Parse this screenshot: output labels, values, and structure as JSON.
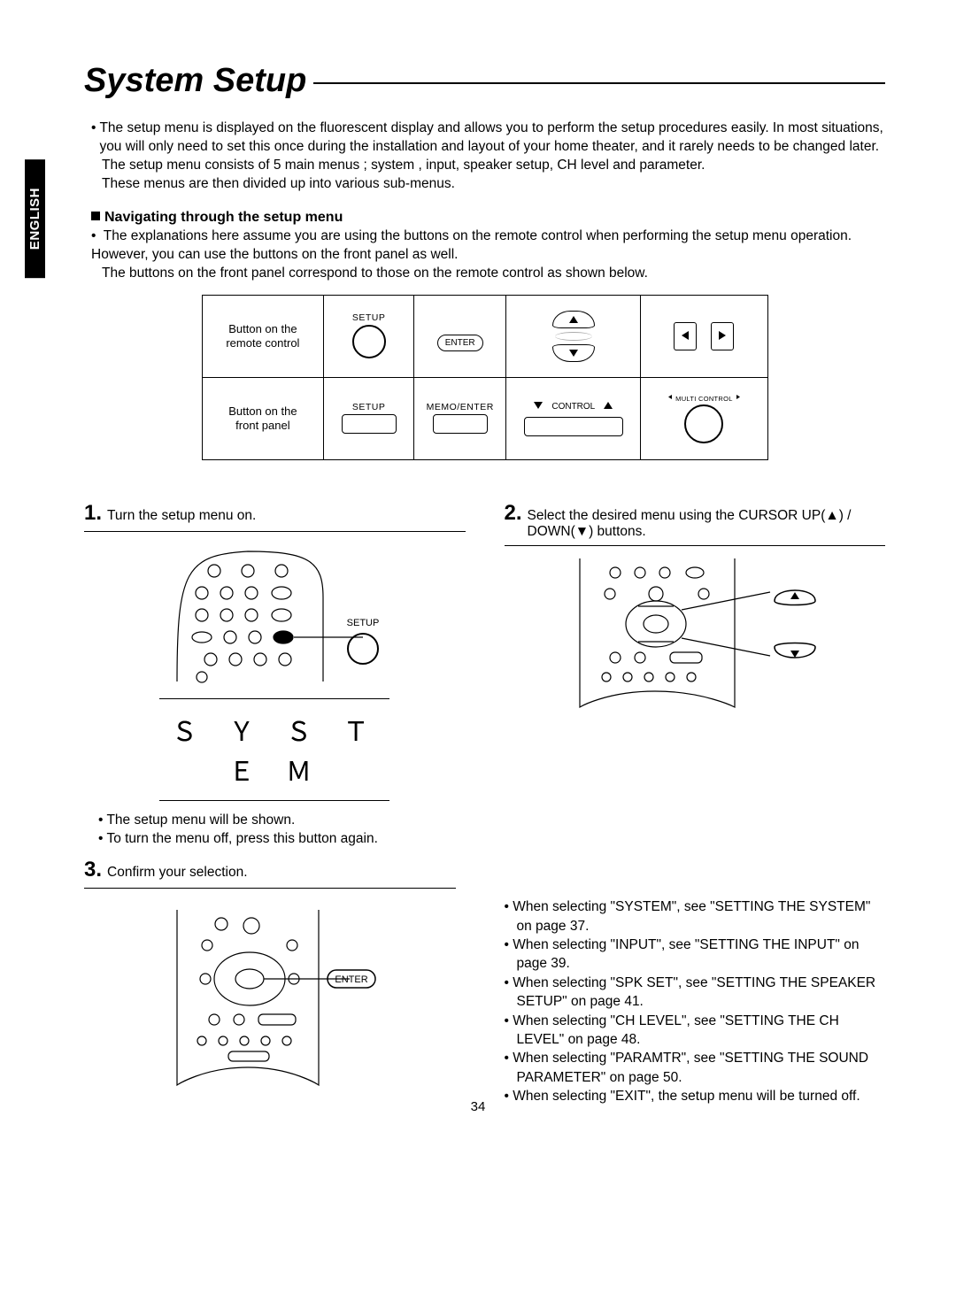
{
  "language_tab": "ENGLISH",
  "title": "System Setup",
  "intro": {
    "bullet": "The setup menu is displayed on the fluorescent display and allows you to perform the setup procedures easily. In most situations, you will only need to set this once during the installation and layout of your home theater, and it rarely needs to be changed later.",
    "line2": "The setup menu consists of 5 main menus ; system , input, speaker setup, CH level and parameter.",
    "line3": "These menus are then divided up into various sub-menus."
  },
  "nav_heading": "Navigating through the setup menu",
  "nav_text": {
    "bullet": "The explanations here assume you are using the buttons on the remote control when performing the setup menu operation. However, you can use the buttons on the front panel as well.",
    "line2": "The buttons on the front panel correspond to those on the remote control as shown below."
  },
  "table": {
    "row1_label": "Button on the remote control",
    "row2_label": "Button on the front panel",
    "setup": "SETUP",
    "enter": "ENTER",
    "memo_enter": "MEMO/ENTER",
    "multi_control": "MULTI CONTROL",
    "control": "CONTROL"
  },
  "step1": {
    "num": "1.",
    "text": "Turn the setup menu on.",
    "display": "SYSTEM",
    "note1": "The setup menu will be shown.",
    "note2": "To turn the menu off, press this button again.",
    "callout": "SETUP"
  },
  "step2": {
    "num": "2.",
    "text": "Select the desired menu using the CURSOR UP(▲) / DOWN(▼) buttons."
  },
  "step3": {
    "num": "3.",
    "text": "Confirm your selection.",
    "callout": "ENTER",
    "refs": [
      "When selecting \"SYSTEM\", see \"SETTING THE SYSTEM\" on page 37.",
      "When selecting \"INPUT\", see \"SETTING THE INPUT\" on page 39.",
      "When selecting \"SPK SET\", see \"SETTING THE SPEAKER SETUP\" on page 41.",
      "When selecting \"CH LEVEL\", see \"SETTING THE CH LEVEL\" on page 48.",
      "When selecting \"PARAMTR\", see \"SETTING THE SOUND PARAMETER\" on page 50.",
      "When selecting \"EXIT\", the setup menu will be turned off."
    ]
  },
  "page_number": "34"
}
